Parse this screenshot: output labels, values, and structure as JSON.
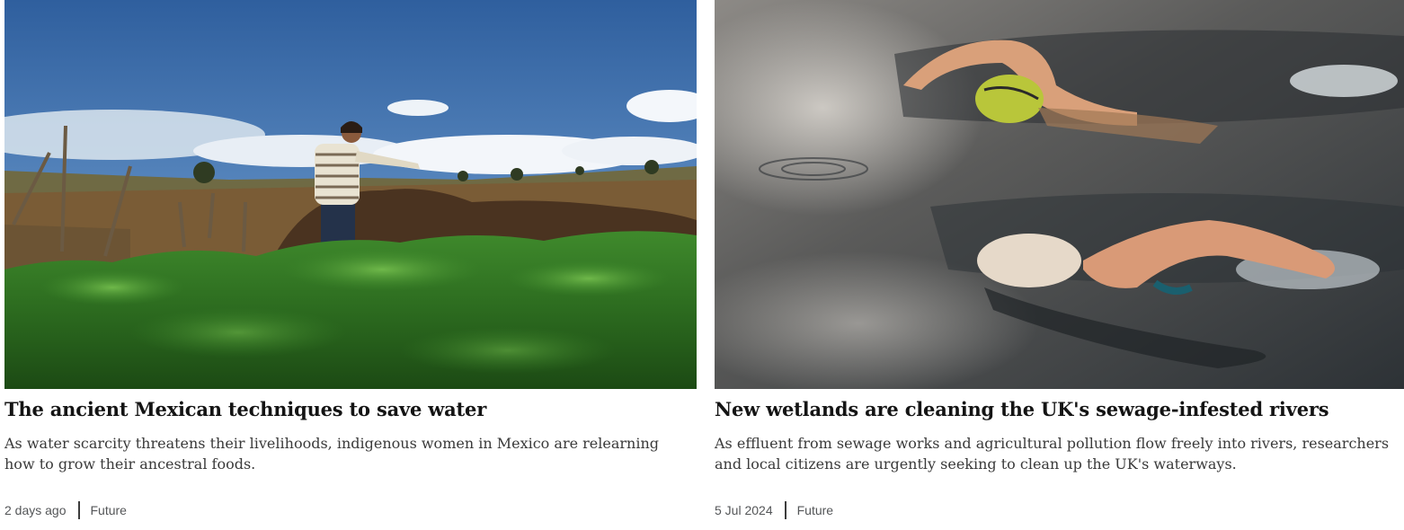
{
  "cards": [
    {
      "headline": "The ancient Mexican techniques to save water",
      "summary": "As water scarcity threatens their livelihoods, indigenous women in Mexico are relearning how to grow their ancestral foods.",
      "date": "2 days ago",
      "category": "Future"
    },
    {
      "headline": "New wetlands are cleaning the UK's sewage-infested rivers",
      "summary": "As effluent from sewage works and agricultural pollution flow freely into rivers, researchers and local citizens are urgently seeking to clean up the UK's waterways.",
      "date": "5 Jul 2024",
      "category": "Future"
    }
  ]
}
